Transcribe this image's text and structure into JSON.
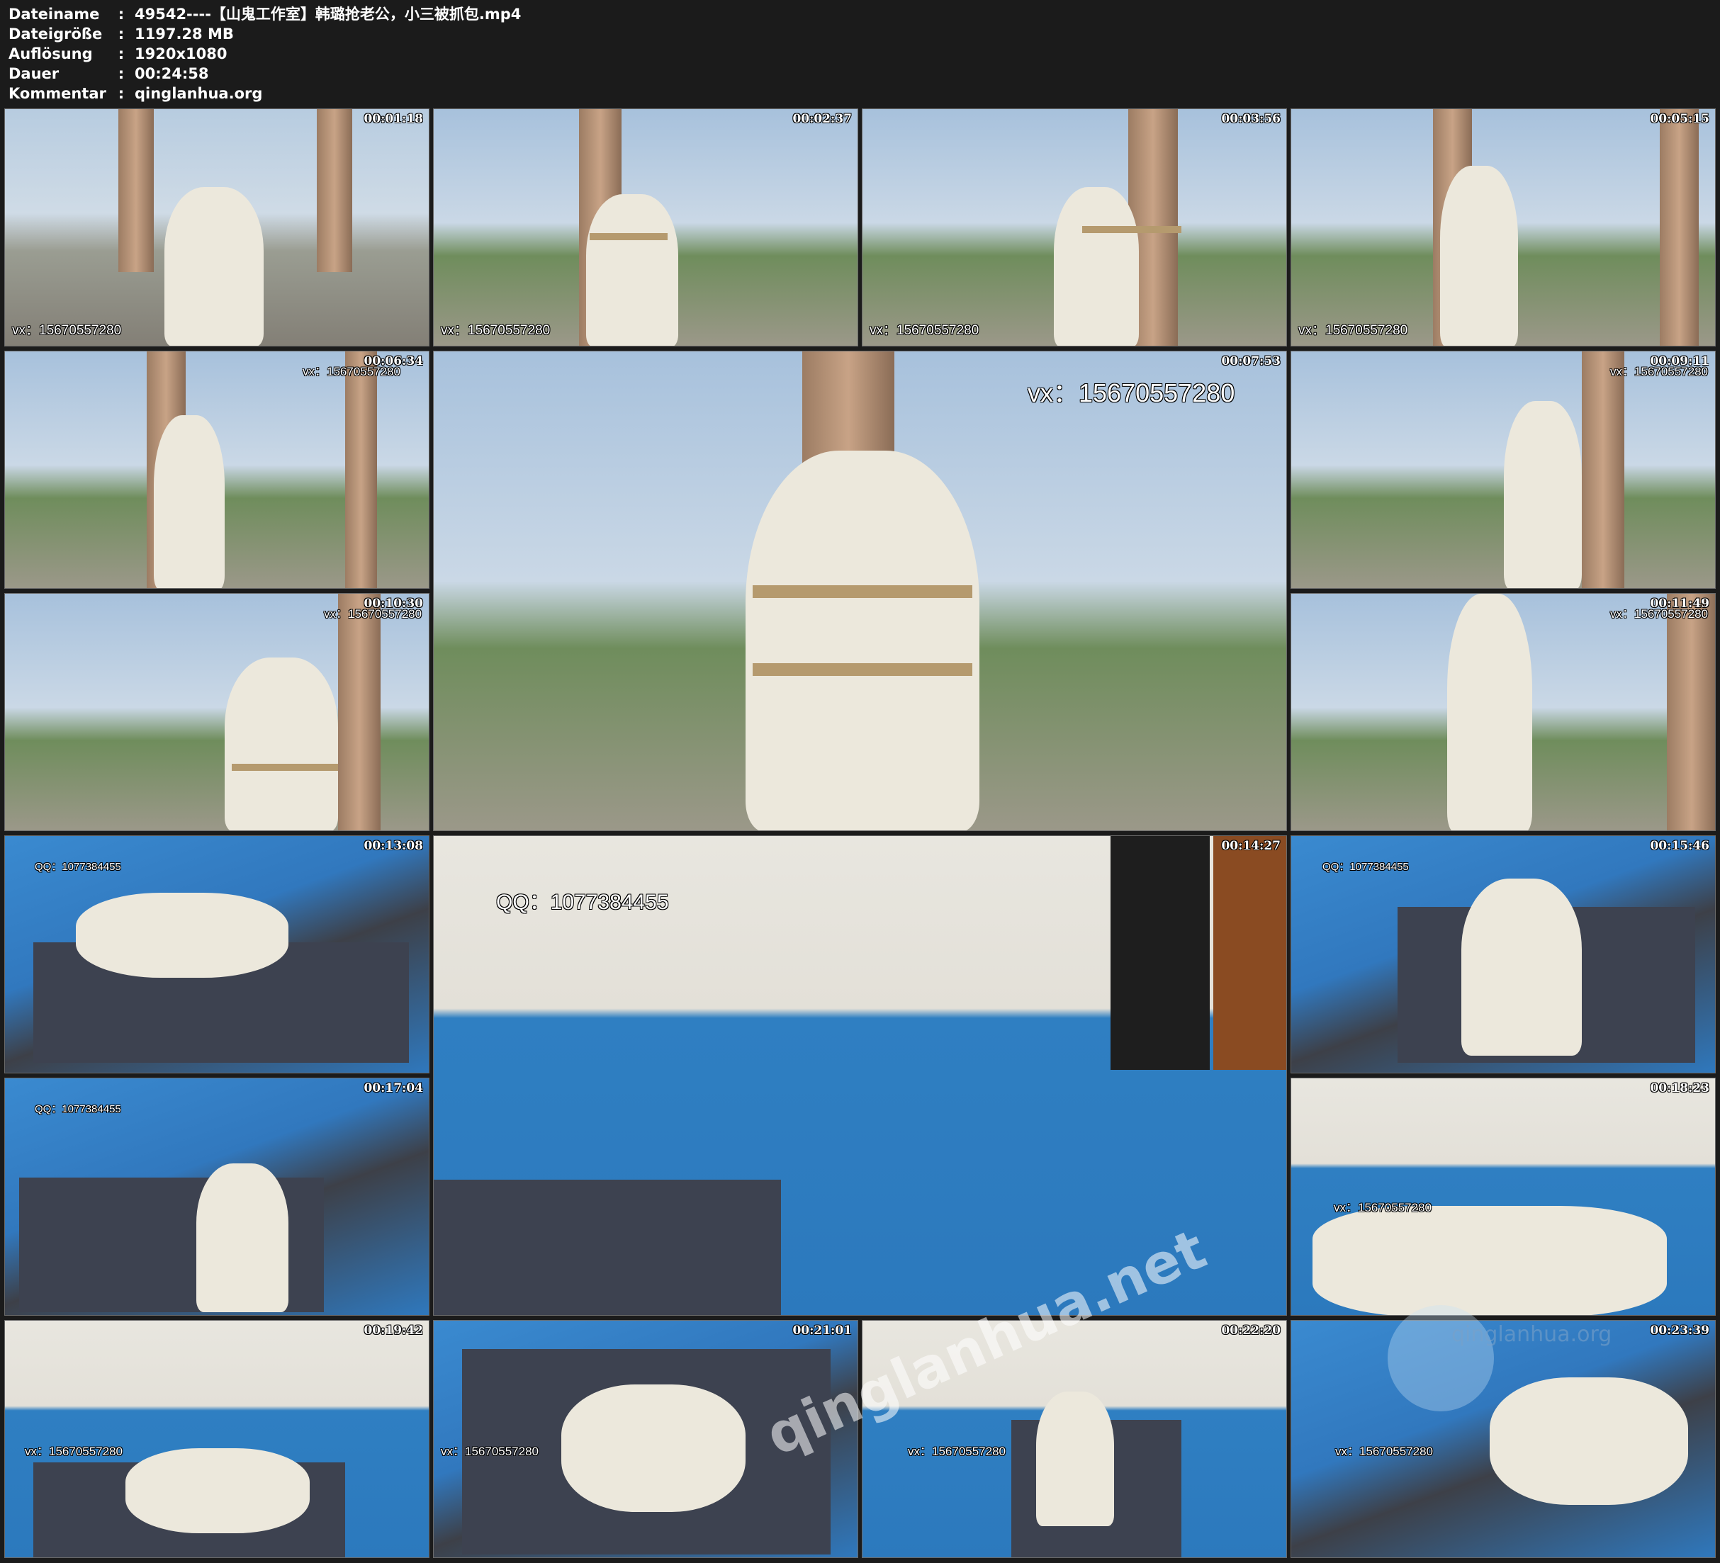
{
  "metadata": [
    {
      "key": "Dateiname",
      "sep": ":",
      "value": "49542----【山鬼工作室】韩璐抢老公，小三被抓包.mp4"
    },
    {
      "key": "Dateigröße",
      "sep": ":",
      "value": "1197.28 MB"
    },
    {
      "key": "Auflösung",
      "sep": ":",
      "value": "1920x1080"
    },
    {
      "key": "Dauer",
      "sep": ":",
      "value": "00:24:58"
    },
    {
      "key": "Kommentar",
      "sep": ":",
      "value": "qinglanhua.org"
    }
  ],
  "frames": [
    {
      "time": "00:01:18",
      "watermark": "vx：15670557280"
    },
    {
      "time": "00:02:37",
      "watermark": "vx：15670557280"
    },
    {
      "time": "00:03:56",
      "watermark": "vx：15670557280"
    },
    {
      "time": "00:05:15",
      "watermark": "vx：15670557280"
    },
    {
      "time": "00:06:34",
      "watermark": "vx：15670557280"
    },
    {
      "time": "00:07:53",
      "watermark": "vx：15670557280"
    },
    {
      "time": "00:09:11",
      "watermark": "vx：15670557280"
    },
    {
      "time": "00:10:30",
      "watermark": "vx：15670557280"
    },
    {
      "time": "00:11:49",
      "watermark": "vx：15670557280"
    },
    {
      "time": "00:13:08",
      "watermark": "QQ：1077384455"
    },
    {
      "time": "00:14:27",
      "watermark": "QQ：1077384455"
    },
    {
      "time": "00:15:46",
      "watermark": "QQ：1077384455"
    },
    {
      "time": "00:17:04",
      "watermark": "QQ：1077384455"
    },
    {
      "time": "00:18:23",
      "watermark": "vx：15670557280"
    },
    {
      "time": "00:19:42",
      "watermark": "vx：15670557280"
    },
    {
      "time": "00:21:01",
      "watermark": "vx：15670557280"
    },
    {
      "time": "00:22:20",
      "watermark": "vx：15670557280"
    },
    {
      "time": "00:23:39",
      "watermark": "vx：15670557280"
    }
  ],
  "overlay_watermark": "qinglanhua.net",
  "overlay_watermark_secondary": "qinglanhua.org"
}
